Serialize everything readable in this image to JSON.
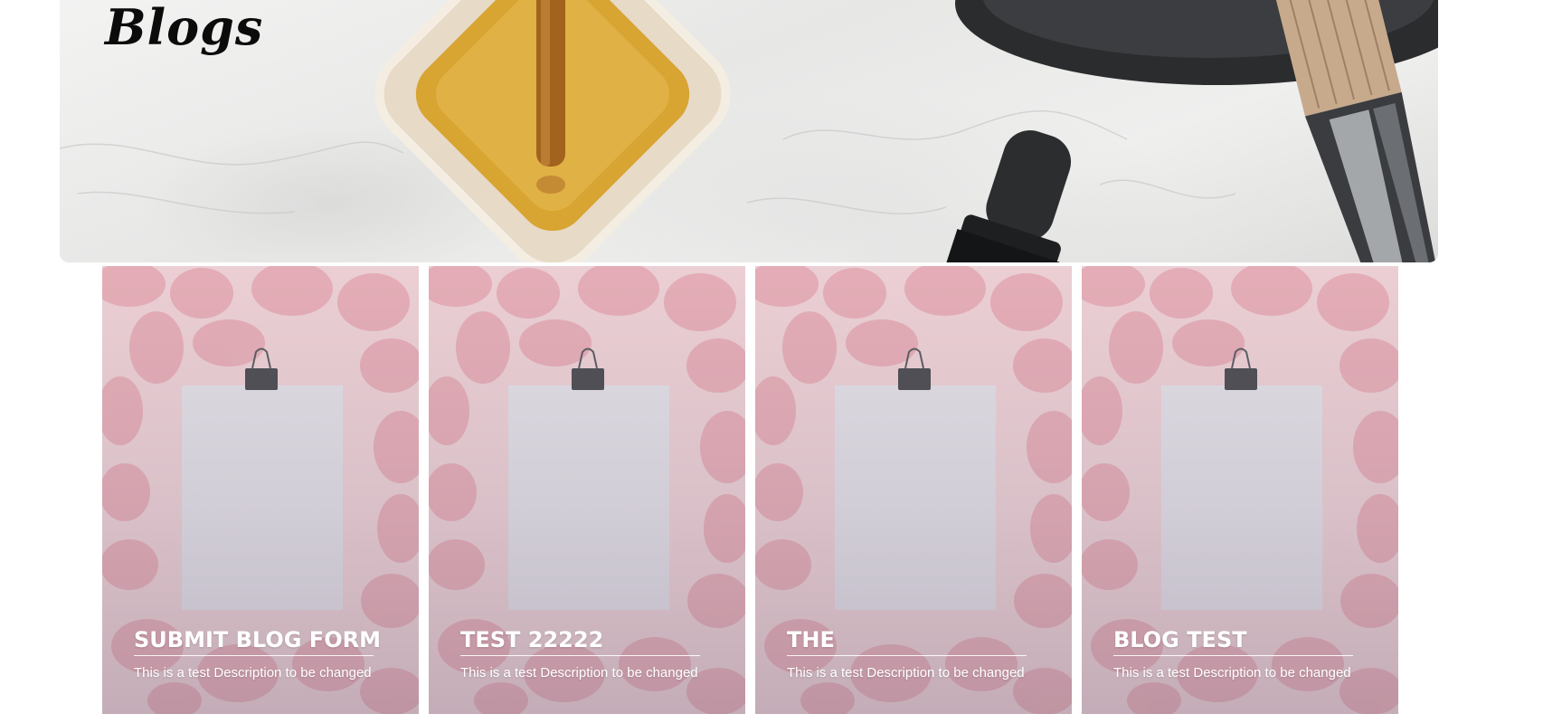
{
  "hero": {
    "title": "Blogs"
  },
  "blog_cards": [
    {
      "title": "SUBMIT BLOG FORM",
      "description": "This is a test Description to be changed"
    },
    {
      "title": "TEST 22222",
      "description": "This is a test Description to be changed"
    },
    {
      "title": "THE",
      "description": "This is a test Description to be changed"
    },
    {
      "title": "BLOG TEST",
      "description": "This is a test Description to be changed"
    }
  ],
  "colors": {
    "page_background": "#ffffff",
    "card_petal_pink": "#ecc4c9",
    "card_text": "#ffffff",
    "hero_title": "#0b0b0b"
  },
  "icons": {
    "binder_clip": "binder-clip-icon"
  }
}
